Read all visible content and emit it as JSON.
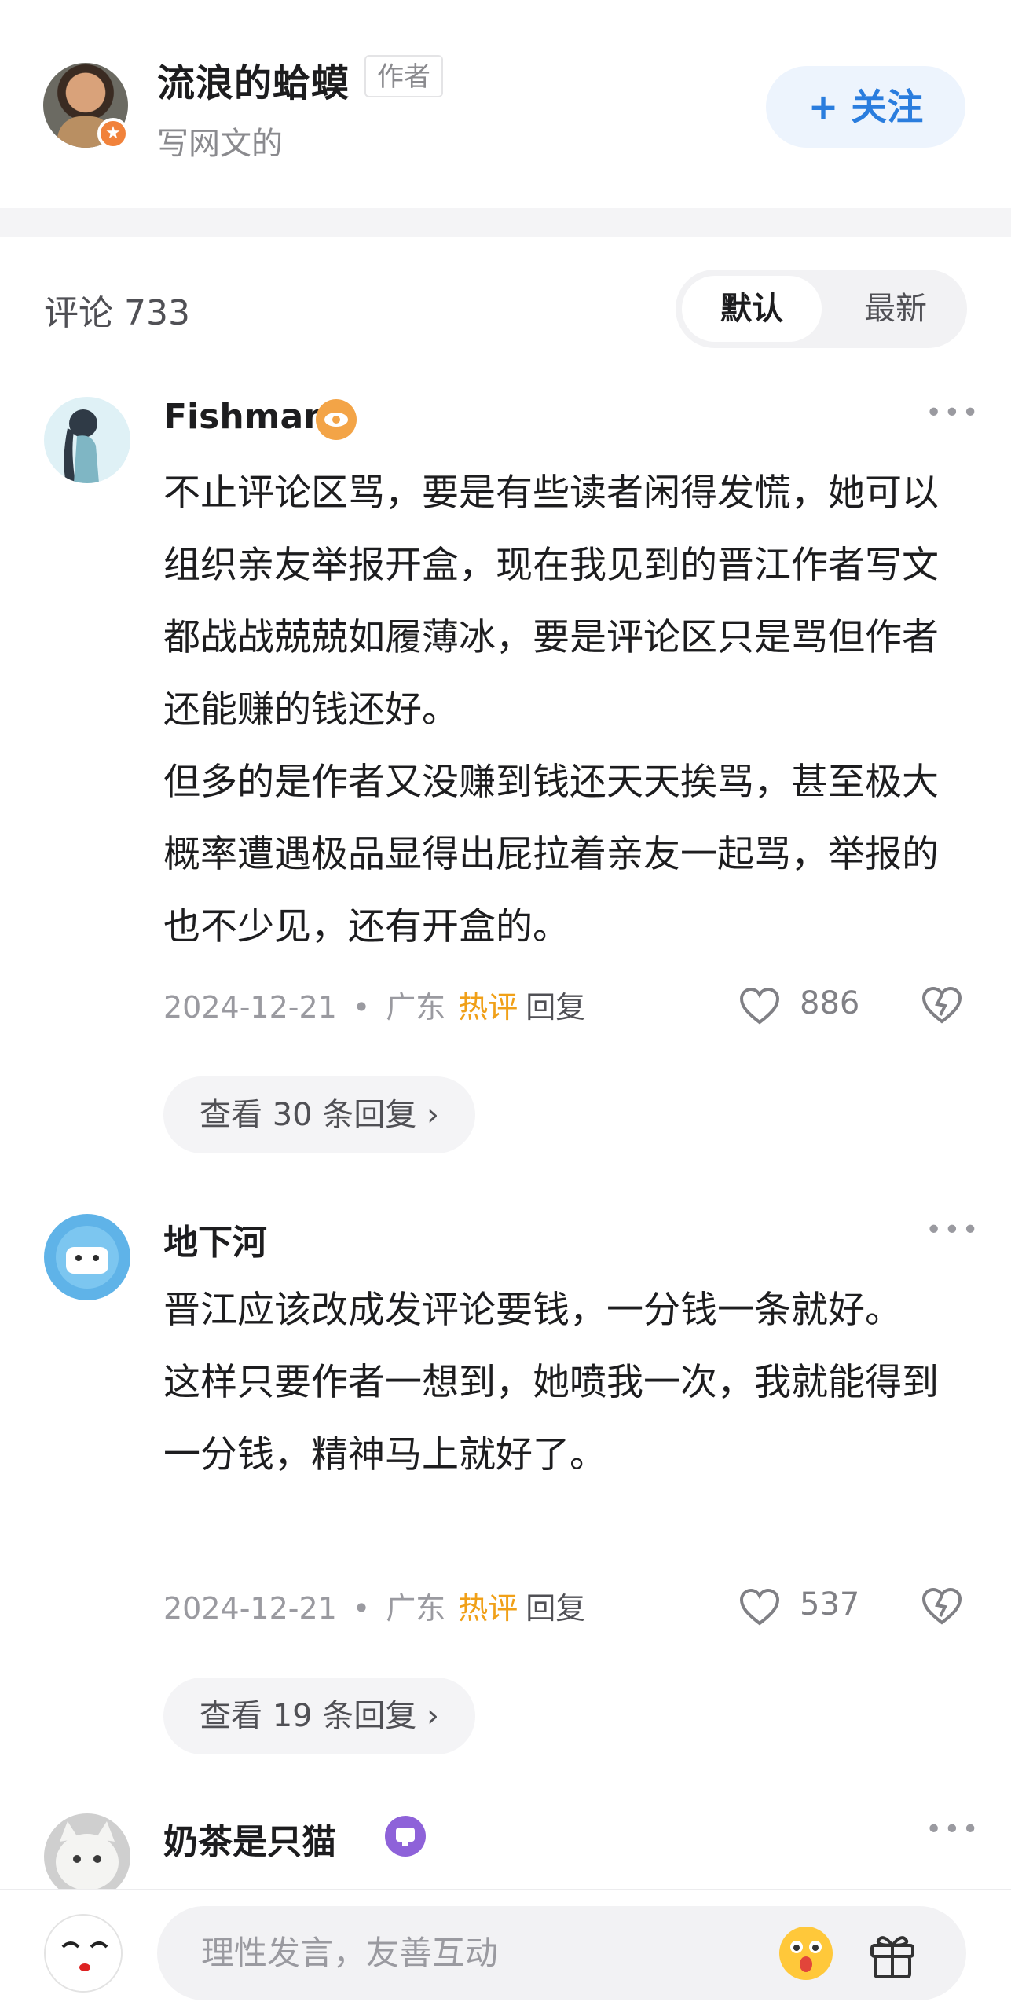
{
  "author": {
    "name": "流浪的蛤蟆",
    "tag": "作者",
    "bio": "写网文的",
    "follow_label": "+ 关注"
  },
  "comments_header": {
    "title": "评论 733",
    "sort_default": "默认",
    "sort_latest": "最新"
  },
  "comments": [
    {
      "user": "Fishman",
      "badge_icon": "eye-badge-icon",
      "body": [
        "不止评论区骂，要是有些读者闲得发慌，她可以组织亲友举报开盒，现在我见到的晋江作者写文都战战兢兢如履薄冰，要是评论区只是骂但作者还能赚的钱还好。",
        "但多的是作者又没赚到钱还天天挨骂，甚至极大概率遭遇极品显得出屁拉着亲友一起骂，举报的也不少见，还有开盒的。"
      ],
      "date": "2024-12-21",
      "location": "广东",
      "hot": "热评",
      "reply": "回复",
      "likes": "886",
      "view_replies": "查看 30 条回复 ›"
    },
    {
      "user": "地下河",
      "body": [
        "晋江应该改成发评论要钱，一分钱一条就好。",
        "这样只要作者一想到，她喷我一次，我就能得到一分钱，精神马上就好了。"
      ],
      "date": "2024-12-21",
      "location": "广东",
      "hot": "热评",
      "reply": "回复",
      "likes": "537",
      "view_replies": "查看 19 条回复 ›"
    },
    {
      "user": "奶茶是只猫",
      "badge_icon": "purple-badge-icon"
    }
  ],
  "bottom_bar": {
    "placeholder": "理性发言，友善互动"
  },
  "colors": {
    "accent": "#2a7dde",
    "hot": "#f0a018",
    "muted": "#9a9aa0"
  }
}
